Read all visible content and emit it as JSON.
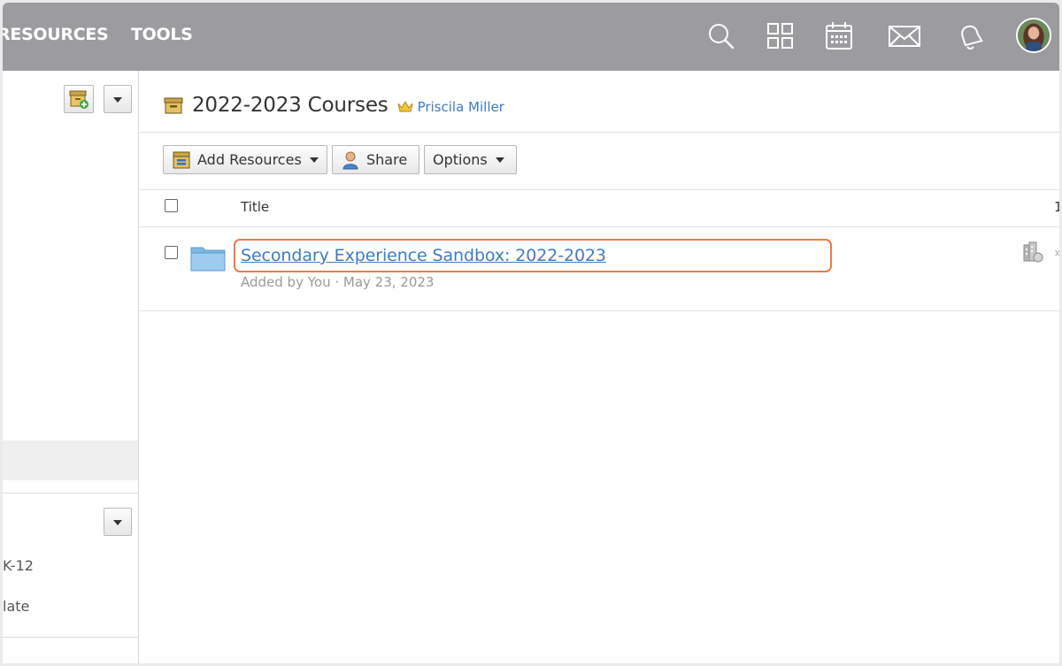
{
  "nav": {
    "resources": "RESOURCES",
    "tools": "TOOLS",
    "icons": [
      "search-icon",
      "apps-grid-icon",
      "calendar-icon",
      "mail-icon",
      "notifications-bell-icon"
    ]
  },
  "sidebar": {
    "items": [
      "K-12",
      "late"
    ]
  },
  "page": {
    "title": "2022-2023 Courses",
    "owner": "Priscila Miller"
  },
  "toolbar": {
    "add_resources": "Add Resources",
    "share": "Share",
    "options": "Options"
  },
  "table": {
    "header_title": "Title",
    "header_right": "1",
    "rows": [
      {
        "title": "Secondary Experience Sandbox: 2022-2023",
        "meta": "Added by You · May 23, 2023",
        "right": "»"
      }
    ]
  },
  "colors": {
    "topbar": "#9c9c9f",
    "link": "#3d7cc0",
    "focus": "#ef7a45",
    "folder": "#8ec5ea"
  }
}
